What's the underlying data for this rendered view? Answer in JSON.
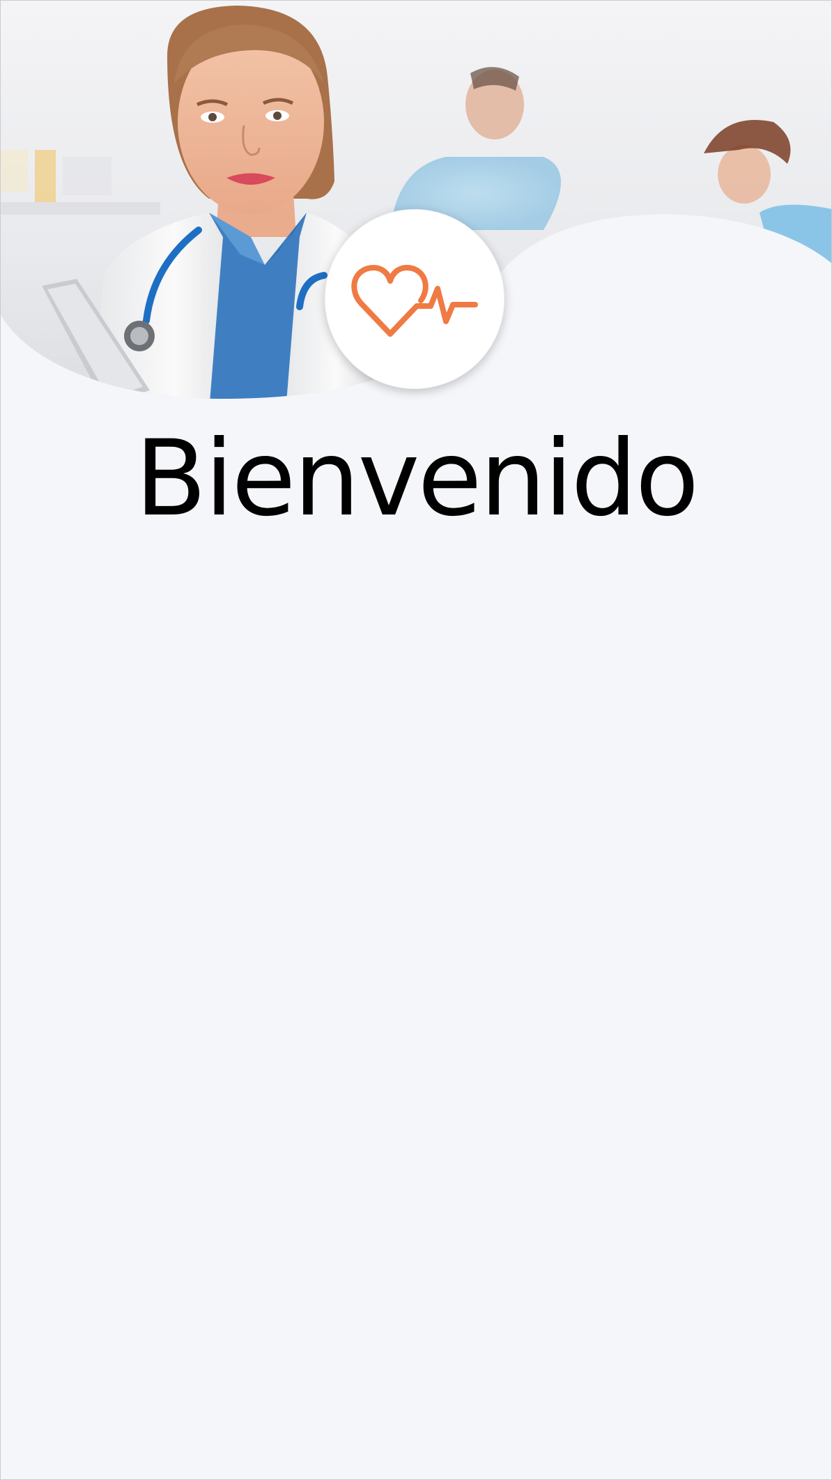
{
  "welcome": {
    "title": "Bienvenido"
  },
  "hero": {
    "image": "medical-staff-photo"
  },
  "logo": {
    "icon": "heart-pulse-icon",
    "color": "#f07a43"
  },
  "colors": {
    "background": "#f5f6fa",
    "accent": "#f07a43"
  }
}
